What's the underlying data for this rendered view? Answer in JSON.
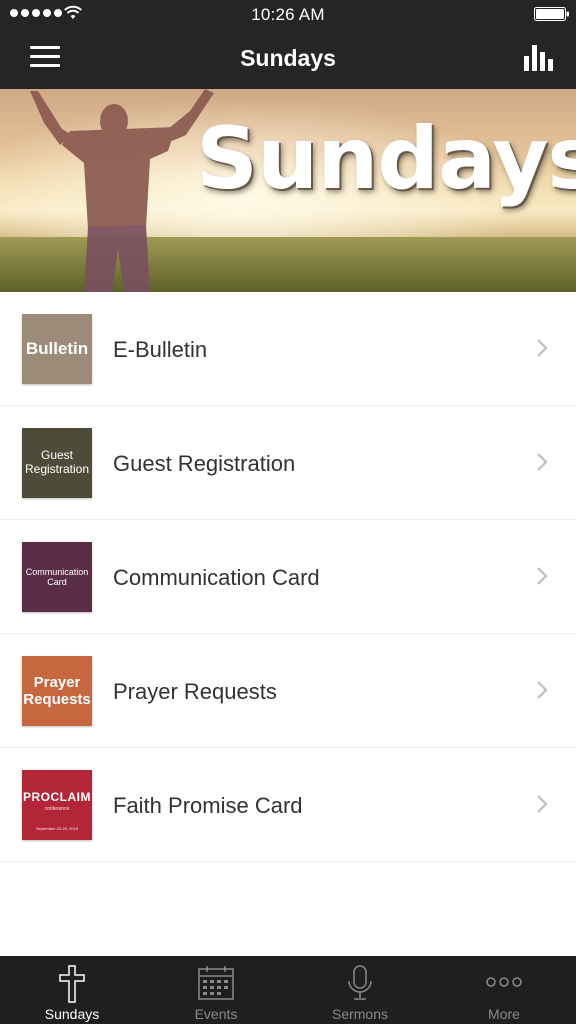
{
  "status_bar": {
    "time": "10:26 AM",
    "signal_icon": "signal-dots-icon",
    "wifi_icon": "wifi-icon",
    "battery_icon": "battery-icon"
  },
  "nav_bar": {
    "title": "Sundays",
    "menu_icon": "hamburger-menu-icon",
    "right_icon": "bar-chart-icon"
  },
  "hero": {
    "title": "Sundays"
  },
  "list": {
    "items": [
      {
        "label": "E-Bulletin",
        "thumb_text": "Bulletin",
        "thumb_color": "#9b8b78"
      },
      {
        "label": "Guest Registration",
        "thumb_text": "Guest Registration",
        "thumb_color": "#4e4c38"
      },
      {
        "label": "Communication Card",
        "thumb_text": "Communication Card",
        "thumb_color": "#5a2d46"
      },
      {
        "label": "Prayer Requests",
        "thumb_text": "Prayer Requests",
        "thumb_color": "#c7673f"
      },
      {
        "label": "Faith Promise Card",
        "thumb_text": "PROCLAIM",
        "thumb_sub": "conference",
        "thumb_date": "September 20-23, 2015",
        "thumb_color": "#b22638"
      }
    ]
  },
  "tab_bar": {
    "active_color": "#ffffff",
    "inactive_color": "#8a8a8a",
    "tabs": [
      {
        "label": "Sundays",
        "icon": "cross-icon",
        "active": true
      },
      {
        "label": "Events",
        "icon": "calendar-icon",
        "active": false
      },
      {
        "label": "Sermons",
        "icon": "microphone-icon",
        "active": false
      },
      {
        "label": "More",
        "icon": "more-dots-icon",
        "active": false
      }
    ]
  }
}
